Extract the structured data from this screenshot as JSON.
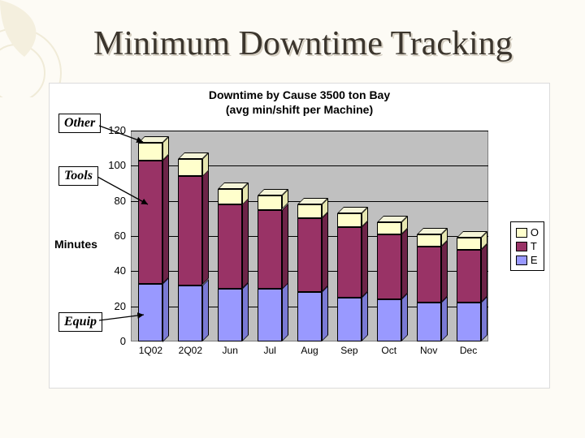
{
  "page": {
    "title": "Minimum Downtime Tracking"
  },
  "chart_data": {
    "type": "bar",
    "stacked": true,
    "title": "Downtime by Cause 3500 ton Bay\n(avg min/shift per Machine)",
    "ylabel": "Minutes",
    "xlabel": "",
    "ylim": [
      0,
      120
    ],
    "ytick_step": 20,
    "categories": [
      "1Q02",
      "2Q02",
      "Jun",
      "Jul",
      "Aug",
      "Sep",
      "Oct",
      "Nov",
      "Dec"
    ],
    "series": [
      {
        "name": "E",
        "color": "#9999ff",
        "values": [
          33,
          32,
          30,
          30,
          28,
          25,
          24,
          22,
          22
        ]
      },
      {
        "name": "T",
        "color": "#993366",
        "values": [
          70,
          62,
          48,
          45,
          42,
          40,
          37,
          32,
          30
        ]
      },
      {
        "name": "O",
        "color": "#ffffcc",
        "values": [
          10,
          10,
          9,
          8,
          8,
          8,
          7,
          7,
          7
        ]
      }
    ],
    "legend": [
      "O",
      "T",
      "E"
    ],
    "annotations": [
      {
        "label": "Other",
        "points_to_series": "O"
      },
      {
        "label": "Tools",
        "points_to_series": "T"
      },
      {
        "label": "Equip",
        "points_to_series": "E"
      }
    ]
  }
}
